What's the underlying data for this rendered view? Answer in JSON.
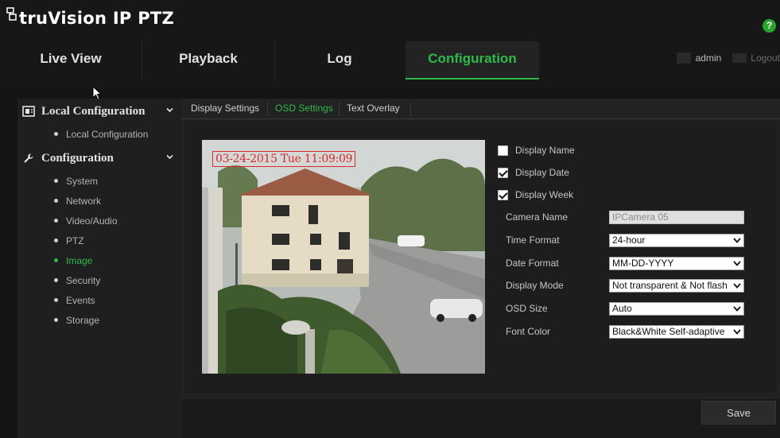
{
  "brand": {
    "name": "truVision IP PTZ"
  },
  "header": {
    "help_icon": "help-icon",
    "help_glyph": "?"
  },
  "nav": {
    "tabs": [
      {
        "label": "Live View"
      },
      {
        "label": "Playback"
      },
      {
        "label": "Log"
      },
      {
        "label": "Configuration",
        "active": true
      }
    ],
    "accent_color": "#2fb94a"
  },
  "user": {
    "name": "admin",
    "logout_label": "Logout"
  },
  "sidebar": {
    "groups": [
      {
        "label": "Local Configuration",
        "icon": "local-config-icon",
        "items": [
          {
            "label": "Local Configuration"
          }
        ]
      },
      {
        "label": "Configuration",
        "icon": "wrench-icon",
        "items": [
          {
            "label": "System"
          },
          {
            "label": "Network"
          },
          {
            "label": "Video/Audio"
          },
          {
            "label": "PTZ"
          },
          {
            "label": "Image",
            "active": true
          },
          {
            "label": "Security"
          },
          {
            "label": "Events"
          },
          {
            "label": "Storage"
          }
        ]
      }
    ]
  },
  "subtabs": [
    {
      "label": "Display Settings"
    },
    {
      "label": "OSD Settings",
      "active": true
    },
    {
      "label": "Text Overlay"
    }
  ],
  "preview": {
    "osd_text": "03-24-2015 Tue 11:09:09"
  },
  "osd": {
    "checkboxes": [
      {
        "label": "Display Name",
        "checked": false
      },
      {
        "label": "Display Date",
        "checked": true
      },
      {
        "label": "Display Week",
        "checked": true
      }
    ],
    "camera_name": {
      "label": "Camera Name",
      "value": "IPCamera 05"
    },
    "fields": [
      {
        "label": "Time Format",
        "value": "24-hour"
      },
      {
        "label": "Date Format",
        "value": "MM-DD-YYYY"
      },
      {
        "label": "Display Mode",
        "value": "Not transparent & Not flash"
      },
      {
        "label": "OSD Size",
        "value": "Auto"
      },
      {
        "label": "Font Color",
        "value": "Black&White Self-adaptive"
      }
    ]
  },
  "actions": {
    "save_label": "Save"
  }
}
